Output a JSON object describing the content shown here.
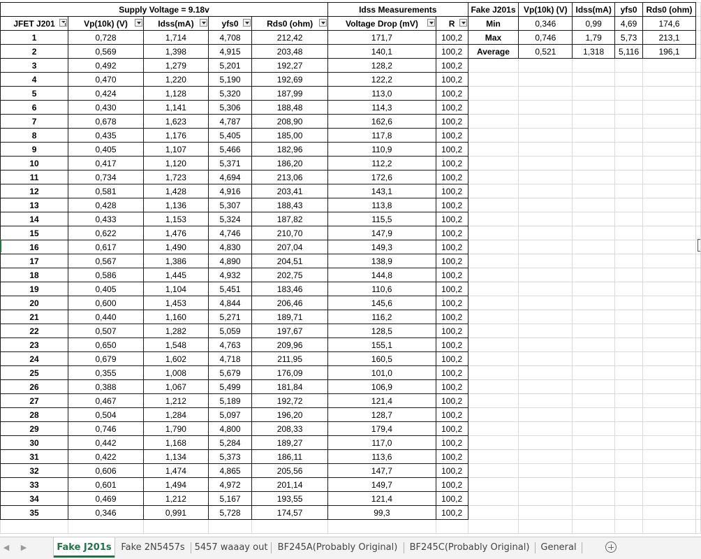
{
  "main_table": {
    "title_supply": "Supply Voltage = 9.18v",
    "title_idss": "Idss Measurements",
    "headers": [
      "JFET J201",
      "Vp(10k) (V)",
      "Idss(mA)",
      "yfs0",
      "Rds0 (ohm)",
      "Voltage Drop (mV)",
      "R"
    ],
    "rows": [
      [
        "1",
        "0,728",
        "1,714",
        "4,708",
        "212,42",
        "171,7",
        "100,2"
      ],
      [
        "2",
        "0,569",
        "1,398",
        "4,915",
        "203,48",
        "140,1",
        "100,2"
      ],
      [
        "3",
        "0,492",
        "1,279",
        "5,201",
        "192,27",
        "128,2",
        "100,2"
      ],
      [
        "4",
        "0,470",
        "1,220",
        "5,190",
        "192,69",
        "122,2",
        "100,2"
      ],
      [
        "5",
        "0,424",
        "1,128",
        "5,320",
        "187,99",
        "113,0",
        "100,2"
      ],
      [
        "6",
        "0,430",
        "1,141",
        "5,306",
        "188,48",
        "114,3",
        "100,2"
      ],
      [
        "7",
        "0,678",
        "1,623",
        "4,787",
        "208,90",
        "162,6",
        "100,2"
      ],
      [
        "8",
        "0,435",
        "1,176",
        "5,405",
        "185,00",
        "117,8",
        "100,2"
      ],
      [
        "9",
        "0,405",
        "1,107",
        "5,466",
        "182,96",
        "110,9",
        "100,2"
      ],
      [
        "10",
        "0,417",
        "1,120",
        "5,371",
        "186,20",
        "112,2",
        "100,2"
      ],
      [
        "11",
        "0,734",
        "1,723",
        "4,694",
        "213,06",
        "172,6",
        "100,2"
      ],
      [
        "12",
        "0,581",
        "1,428",
        "4,916",
        "203,41",
        "143,1",
        "100,2"
      ],
      [
        "13",
        "0,428",
        "1,136",
        "5,307",
        "188,43",
        "113,8",
        "100,2"
      ],
      [
        "14",
        "0,433",
        "1,153",
        "5,324",
        "187,82",
        "115,5",
        "100,2"
      ],
      [
        "15",
        "0,622",
        "1,476",
        "4,746",
        "210,70",
        "147,9",
        "100,2"
      ],
      [
        "16",
        "0,617",
        "1,490",
        "4,830",
        "207,04",
        "149,3",
        "100,2"
      ],
      [
        "17",
        "0,567",
        "1,386",
        "4,890",
        "204,51",
        "138,9",
        "100,2"
      ],
      [
        "18",
        "0,586",
        "1,445",
        "4,932",
        "202,75",
        "144,8",
        "100,2"
      ],
      [
        "19",
        "0,405",
        "1,104",
        "5,451",
        "183,46",
        "110,6",
        "100,2"
      ],
      [
        "20",
        "0,600",
        "1,453",
        "4,844",
        "206,46",
        "145,6",
        "100,2"
      ],
      [
        "21",
        "0,440",
        "1,160",
        "5,271",
        "189,71",
        "116,2",
        "100,2"
      ],
      [
        "22",
        "0,507",
        "1,282",
        "5,059",
        "197,67",
        "128,5",
        "100,2"
      ],
      [
        "23",
        "0,650",
        "1,548",
        "4,763",
        "209,96",
        "155,1",
        "100,2"
      ],
      [
        "24",
        "0,679",
        "1,602",
        "4,718",
        "211,95",
        "160,5",
        "100,2"
      ],
      [
        "25",
        "0,355",
        "1,008",
        "5,679",
        "176,09",
        "101,0",
        "100,2"
      ],
      [
        "26",
        "0,388",
        "1,067",
        "5,499",
        "181,84",
        "106,9",
        "100,2"
      ],
      [
        "27",
        "0,467",
        "1,212",
        "5,189",
        "192,72",
        "121,4",
        "100,2"
      ],
      [
        "28",
        "0,504",
        "1,284",
        "5,097",
        "196,20",
        "128,7",
        "100,2"
      ],
      [
        "29",
        "0,746",
        "1,790",
        "4,800",
        "208,33",
        "179,4",
        "100,2"
      ],
      [
        "30",
        "0,442",
        "1,168",
        "5,284",
        "189,27",
        "117,0",
        "100,2"
      ],
      [
        "31",
        "0,422",
        "1,134",
        "5,373",
        "186,11",
        "113,6",
        "100,2"
      ],
      [
        "32",
        "0,606",
        "1,474",
        "4,865",
        "205,56",
        "147,7",
        "100,2"
      ],
      [
        "33",
        "0,601",
        "1,494",
        "4,972",
        "201,14",
        "149,7",
        "100,2"
      ],
      [
        "34",
        "0,469",
        "1,212",
        "5,167",
        "193,55",
        "121,4",
        "100,2"
      ],
      [
        "35",
        "0,346",
        "0,991",
        "5,728",
        "174,57",
        "99,3",
        "100,2"
      ]
    ]
  },
  "stats_table": {
    "headers": [
      "Fake J201s",
      "Vp(10k) (V)",
      "Idss(mA)",
      "yfs0",
      "Rds0 (ohm)"
    ],
    "rows": [
      [
        "Min",
        "0,346",
        "0,99",
        "4,69",
        "174,6"
      ],
      [
        "Max",
        "0,746",
        "1,79",
        "5,73",
        "213,1"
      ],
      [
        "Average",
        "0,521",
        "1,318",
        "5,116",
        "196,1"
      ]
    ]
  },
  "sheet_tabs": [
    {
      "label": "Fake J201s",
      "active": true
    },
    {
      "label": "Fake 2N5457s",
      "active": false
    },
    {
      "label": "5457 waaay out",
      "active": false
    },
    {
      "label": "BF245A(Probably Original)",
      "active": false
    },
    {
      "label": "BF245C(Probably Original)",
      "active": false
    },
    {
      "label": "General",
      "active": false
    }
  ],
  "icons": {
    "prev": "nav-left-icon",
    "next": "nav-right-icon",
    "add": "add-sheet-icon",
    "filter": "filter-dropdown-icon",
    "sort": "sort-filter-icon"
  },
  "colors": {
    "accent": "#217346",
    "border": "#1a1a1a",
    "empty_grid": "#d9d9d9"
  }
}
